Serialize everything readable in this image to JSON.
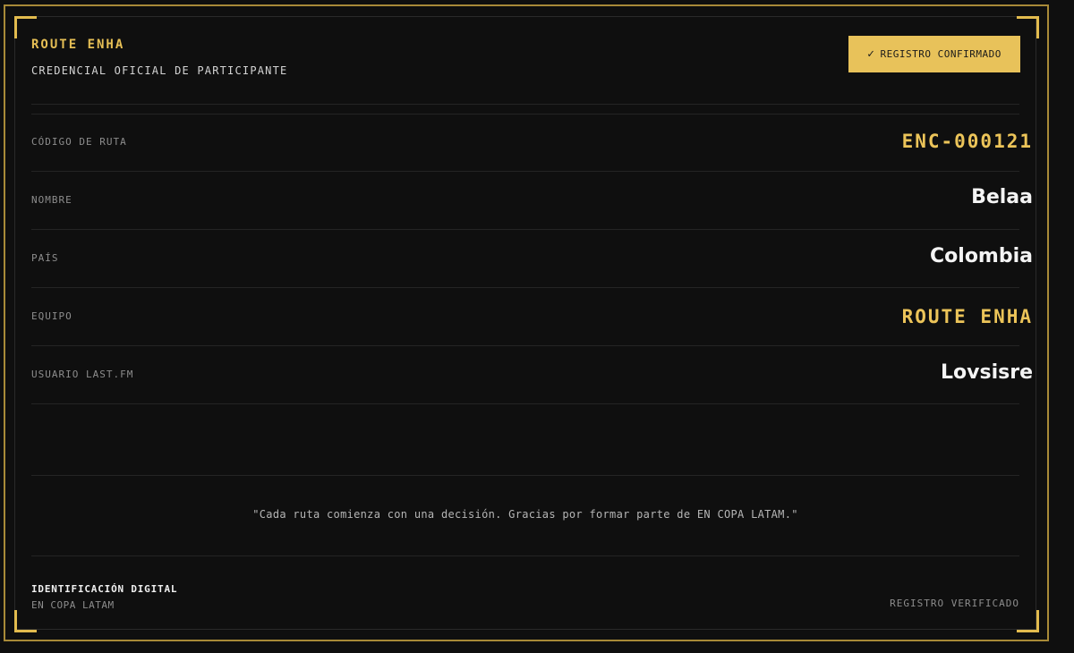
{
  "header": {
    "title": "ROUTE ENHA",
    "subtitle": "CREDENCIAL OFICIAL DE PARTICIPANTE",
    "badge": {
      "icon": "check-icon",
      "icon_glyph": "✓",
      "label": "REGISTRO CONFIRMADO"
    }
  },
  "fields": [
    {
      "label": "CÓDIGO DE RUTA",
      "value": "ENC-000121",
      "style": "accent"
    },
    {
      "label": "NOMBRE",
      "value": "Belaa",
      "style": "plain"
    },
    {
      "label": "PAÍS",
      "value": "Colombia",
      "style": "plain"
    },
    {
      "label": "EQUIPO",
      "value": "ROUTE ENHA",
      "style": "accent"
    },
    {
      "label": "USUARIO LAST.FM",
      "value": "Lovsisre",
      "style": "plain"
    }
  ],
  "quote": "\"Cada ruta comienza con una decisión. Gracias por formar parte de EN COPA LATAM.\"",
  "footer": {
    "title": "IDENTIFICACIÓN DIGITAL",
    "subtitle": "EN COPA LATAM",
    "status": "REGISTRO VERIFICADO"
  },
  "colors": {
    "accent": "#e6bf55",
    "badge_bg": "#e8c25a",
    "background": "#0f0f0f",
    "frame": "#a88a38"
  }
}
